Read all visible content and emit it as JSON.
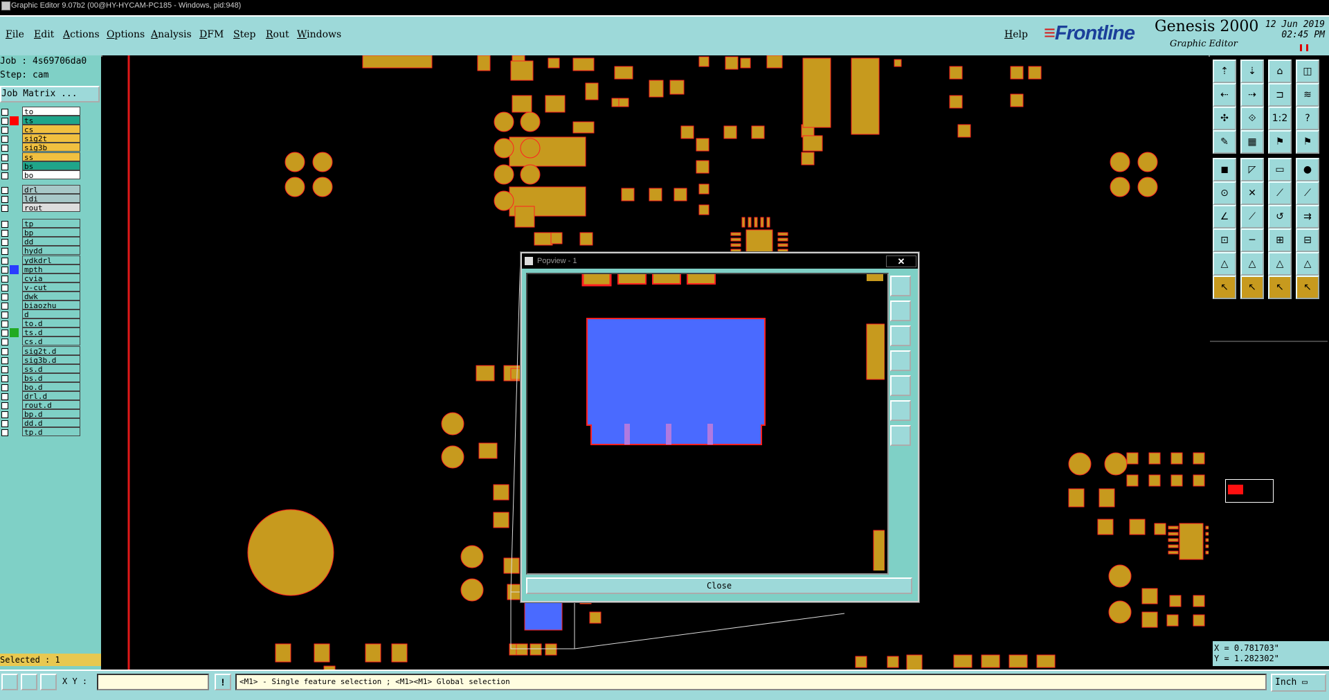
{
  "window": {
    "title": "Graphic Editor 9.07b2 (00@HY-HYCAM-PC185 - Windows, pid:948)"
  },
  "menu": {
    "items": [
      "File",
      "Edit",
      "Actions",
      "Options",
      "Analysis",
      "DFM",
      "Step",
      "Rout",
      "Windows"
    ],
    "help": "Help"
  },
  "logo": {
    "brand": "Frontline",
    "product": "Genesis 2000",
    "subtitle": "Graphic Editor",
    "date": "12 Jun 2019",
    "time": "02:45 PM"
  },
  "info": {
    "job": "Job : 4s69706da0",
    "step": "Step: cam",
    "job_matrix": "Job Matrix ..."
  },
  "layers": [
    {
      "name": "to",
      "color": "#ffffff",
      "marker": "",
      "edit": true
    },
    {
      "name": "ts",
      "color": "#1fa58a",
      "marker": "#ff0000",
      "edit": true
    },
    {
      "name": "cs",
      "color": "#f0c040",
      "marker": "",
      "edit": true
    },
    {
      "name": "sig2t",
      "color": "#f0c040",
      "marker": "",
      "edit": false
    },
    {
      "name": "sig3b",
      "color": "#f0c040",
      "marker": "",
      "edit": false
    },
    {
      "name": "ss",
      "color": "#f0c040",
      "marker": "",
      "edit": true
    },
    {
      "name": "bs",
      "color": "#1fa58a",
      "marker": "",
      "edit": true
    },
    {
      "name": "bo",
      "color": "#ffffff",
      "marker": "",
      "edit": true
    },
    {
      "name": "drl",
      "color": "#a8c8c8",
      "marker": "",
      "edit": false
    },
    {
      "name": "ldi",
      "color": "#a8c8c8",
      "marker": "",
      "edit": false
    },
    {
      "name": "rout",
      "color": "#dddddd",
      "marker": "",
      "edit": false
    },
    {
      "name": "tp",
      "color": "#7fd0c6",
      "marker": "",
      "edit": true
    },
    {
      "name": "bp",
      "color": "#7fd0c6",
      "marker": "",
      "edit": true
    },
    {
      "name": "dd",
      "color": "#7fd0c6",
      "marker": "",
      "edit": true
    },
    {
      "name": "hydd",
      "color": "#7fd0c6",
      "marker": "",
      "edit": false
    },
    {
      "name": "ydkdrl",
      "color": "#7fd0c6",
      "marker": "",
      "edit": false
    },
    {
      "name": "mpth",
      "color": "#7fd0c6",
      "marker": "#2a3cff",
      "edit": false
    },
    {
      "name": "cvia",
      "color": "#7fd0c6",
      "marker": "",
      "edit": false
    },
    {
      "name": "v-cut",
      "color": "#7fd0c6",
      "marker": "",
      "edit": false
    },
    {
      "name": "dwk",
      "color": "#7fd0c6",
      "marker": "",
      "edit": false
    },
    {
      "name": "biaozhu",
      "color": "#7fd0c6",
      "marker": "",
      "edit": false
    },
    {
      "name": "d",
      "color": "#7fd0c6",
      "marker": "",
      "edit": false
    },
    {
      "name": "to.d",
      "color": "#7fd0c6",
      "marker": "",
      "edit": true
    },
    {
      "name": "ts.d",
      "color": "#7fd0c6",
      "marker": "#22aa22",
      "edit": true
    },
    {
      "name": "cs.d",
      "color": "#7fd0c6",
      "marker": "",
      "edit": true
    },
    {
      "name": "sig2t.d",
      "color": "#7fd0c6",
      "marker": "",
      "edit": false
    },
    {
      "name": "sig3b.d",
      "color": "#7fd0c6",
      "marker": "",
      "edit": false
    },
    {
      "name": "ss.d",
      "color": "#7fd0c6",
      "marker": "",
      "edit": true
    },
    {
      "name": "bs.d",
      "color": "#7fd0c6",
      "marker": "",
      "edit": true
    },
    {
      "name": "bo.d",
      "color": "#7fd0c6",
      "marker": "",
      "edit": true
    },
    {
      "name": "drl.d",
      "color": "#7fd0c6",
      "marker": "",
      "edit": false
    },
    {
      "name": "rout.d",
      "color": "#7fd0c6",
      "marker": "",
      "edit": false
    },
    {
      "name": "bp.d",
      "color": "#7fd0c6",
      "marker": "",
      "edit": true
    },
    {
      "name": "dd.d",
      "color": "#7fd0c6",
      "marker": "",
      "edit": true
    },
    {
      "name": "tp.d",
      "color": "#7fd0c6",
      "marker": "",
      "edit": true
    }
  ],
  "selected": "Selected : 1",
  "popview": {
    "title": "Popview - 1",
    "close_label": "Close"
  },
  "coords": {
    "x": "X = 0.781703\"",
    "y": "Y = 1.282302\""
  },
  "bottom": {
    "xy_label": "X Y :",
    "xy_value": "",
    "prompt": "<M1> - Single feature selection ; <M1><M1> Global selection",
    "units": "Inch"
  },
  "colors": {
    "pad": "#c79a1e",
    "pad_outline": "#ff2020",
    "highlight": "#4a6aff",
    "panel": "#7fd0c6",
    "menu": "#9dd9d9"
  }
}
